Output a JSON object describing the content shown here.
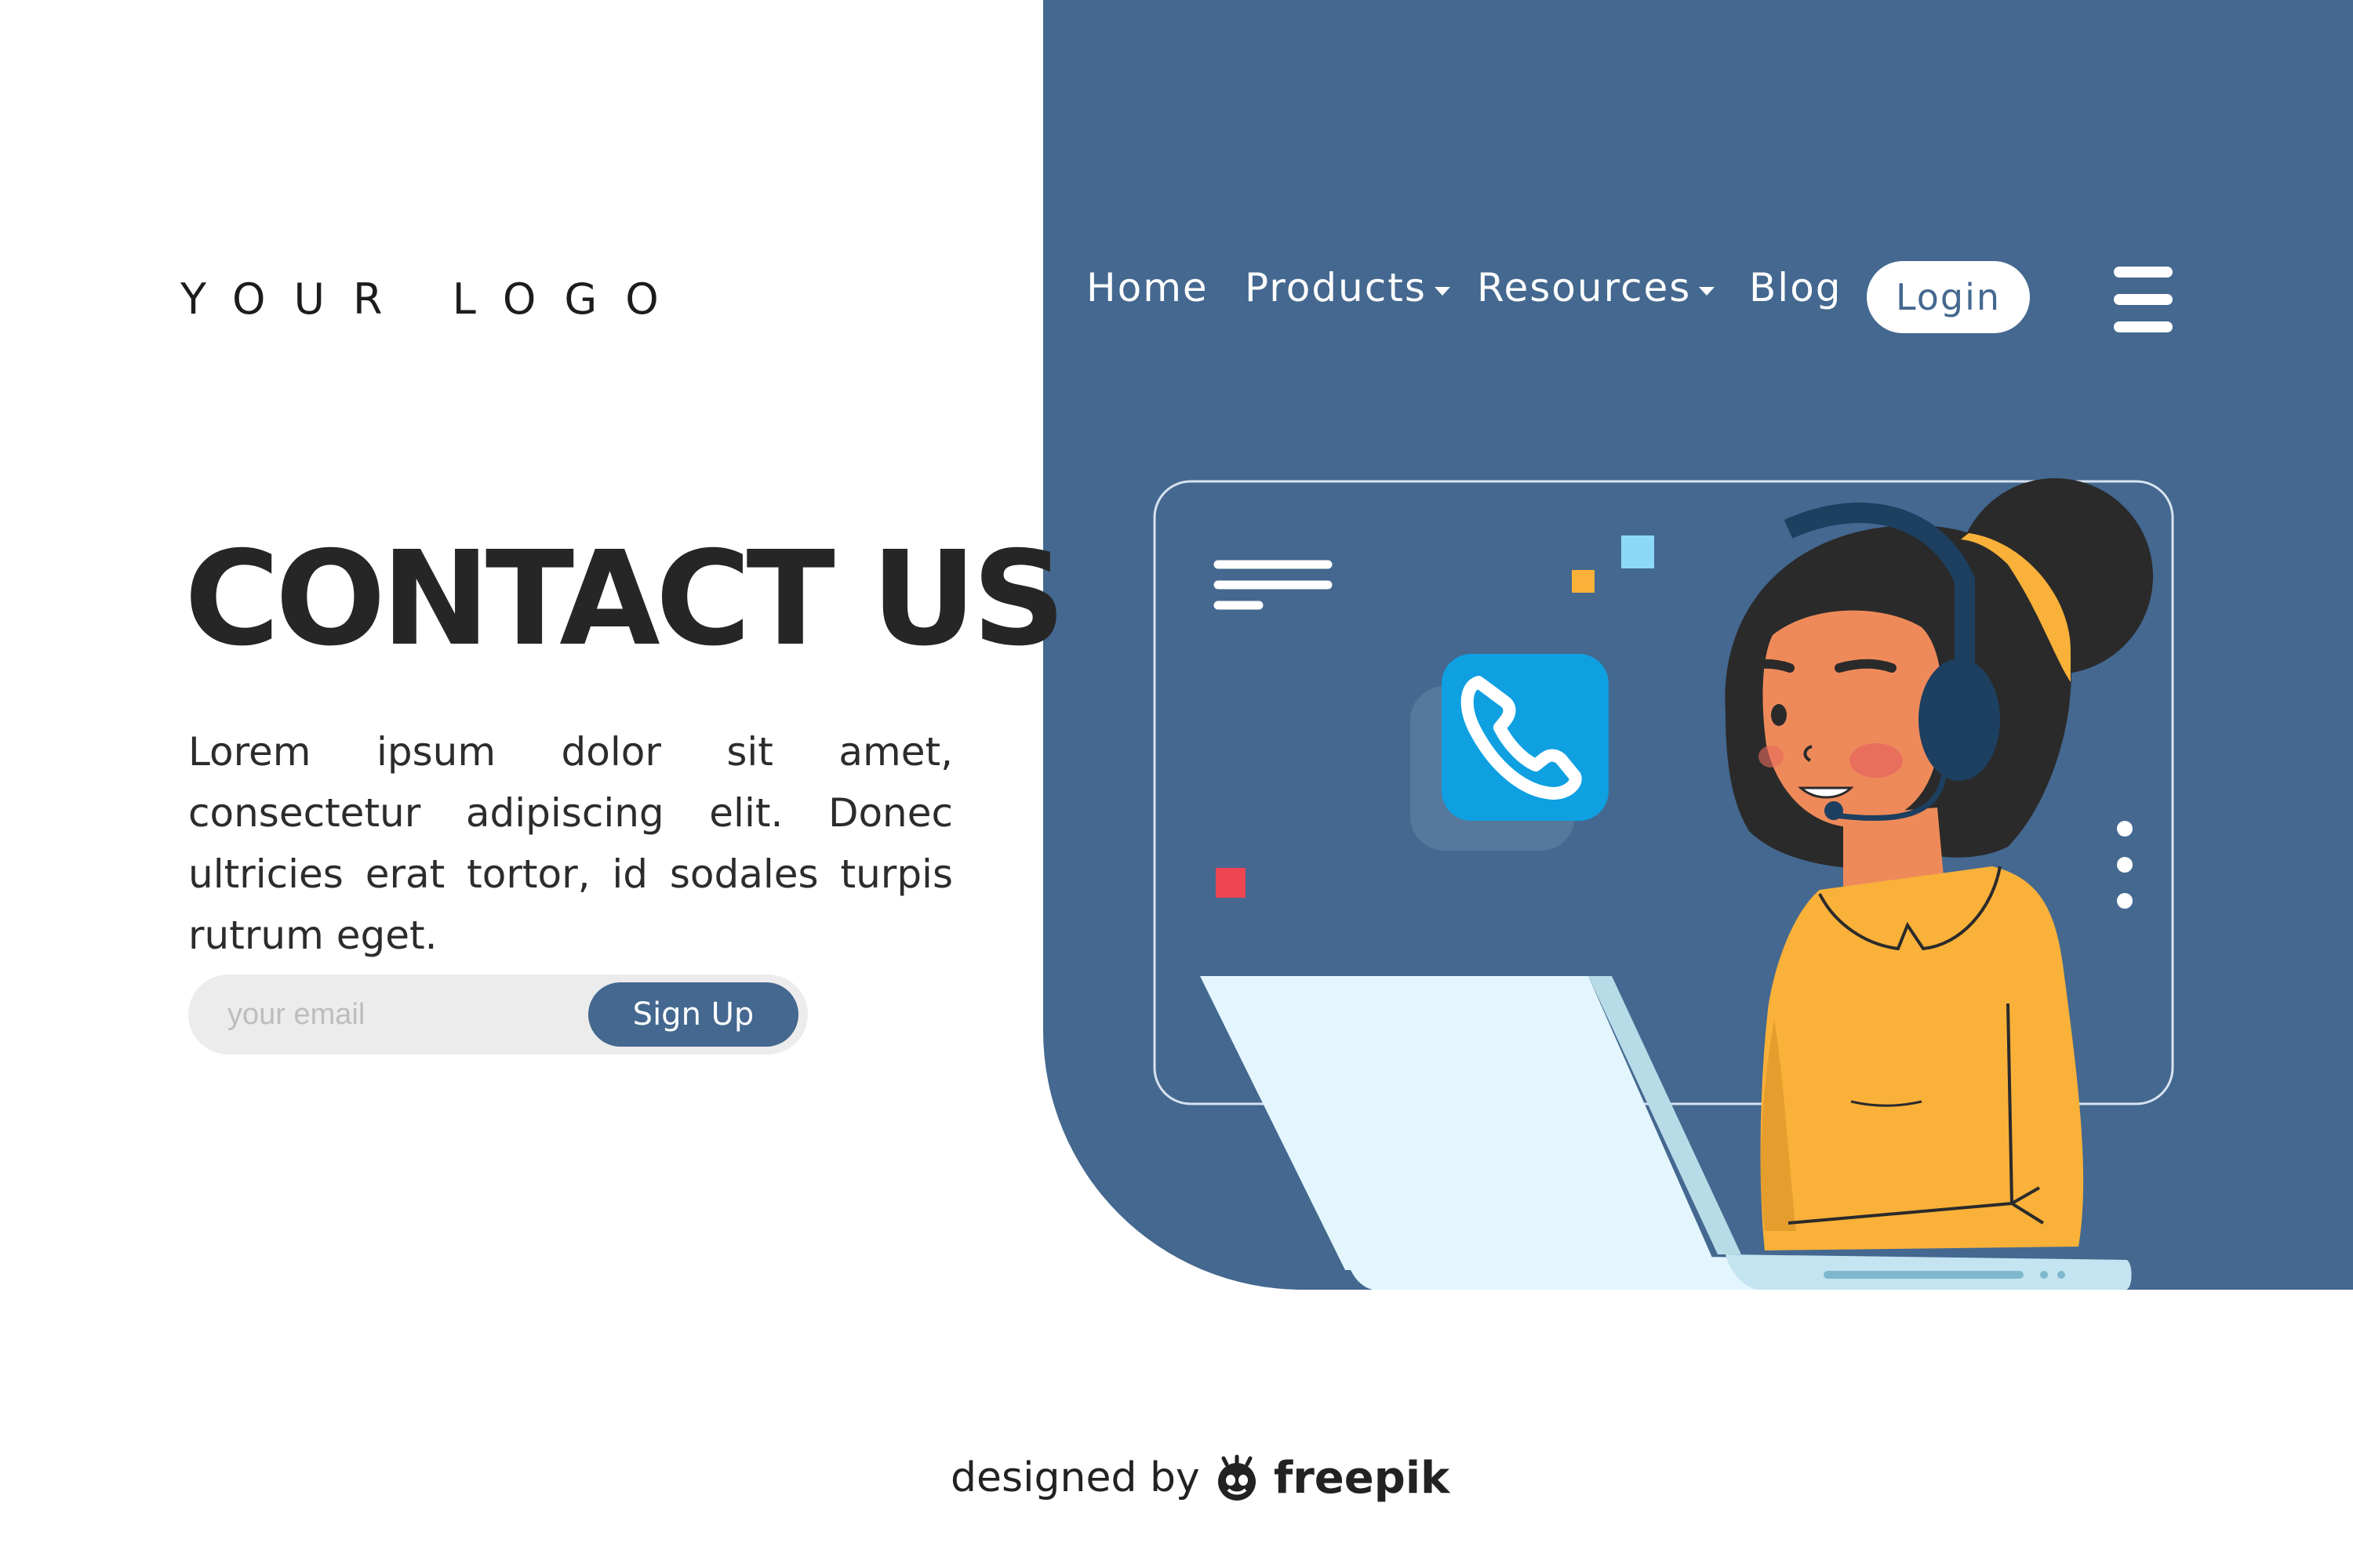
{
  "brand": {
    "logo_text": "YOUR LOGO"
  },
  "nav": {
    "items": [
      {
        "label": "Home"
      },
      {
        "label": "Products"
      },
      {
        "label": "Resources"
      },
      {
        "label": "Blog"
      }
    ],
    "login_label": "Login"
  },
  "hero": {
    "headline": "CONTACT US",
    "description": "Lorem ipsum dolor sit amet, consectetur adipiscing elit. Donec ultricies erat tortor, id sodales turpis rutrum eget.",
    "email_placeholder": "your email",
    "signup_label": "Sign Up"
  },
  "footer": {
    "credit_prefix": "designed by",
    "credit_brand": "freepik"
  },
  "colors": {
    "panel": "#44688f",
    "text_dark": "#262626",
    "shirt": "#f9b13a",
    "call_button": "#0ea0e1",
    "laptop": "#e3f6fd"
  }
}
